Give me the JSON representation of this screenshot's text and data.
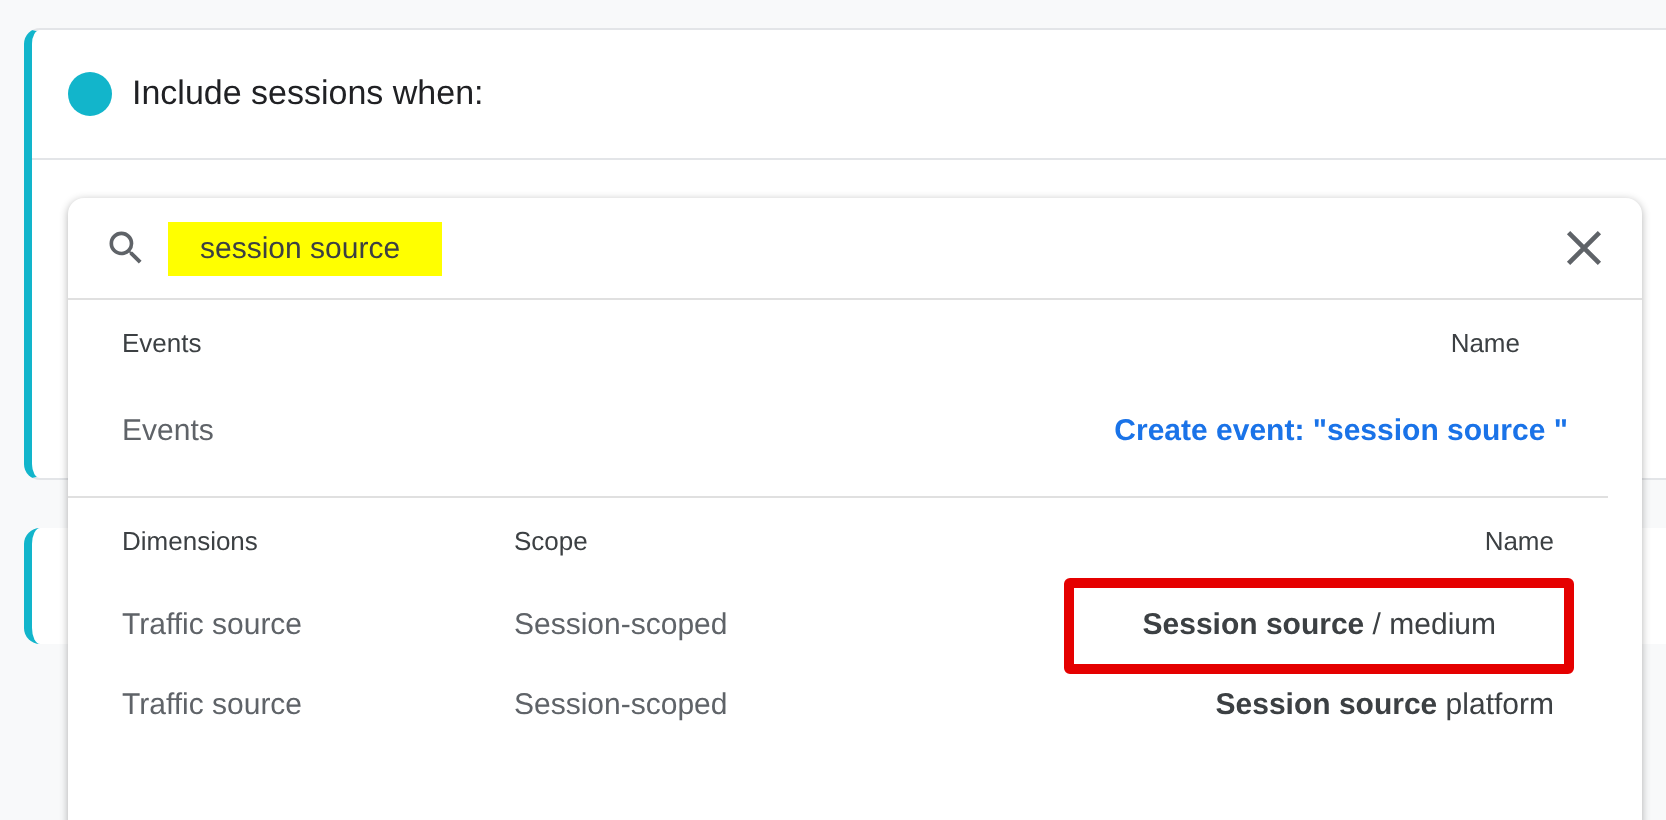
{
  "card": {
    "title": "Include sessions when:"
  },
  "search": {
    "value": "session source",
    "highlighted": true
  },
  "events": {
    "columns": [
      "Events",
      "Name"
    ],
    "rows": [
      {
        "category": "Events",
        "action": "Create event: \"session source \""
      }
    ]
  },
  "dimensions": {
    "columns": [
      "Dimensions",
      "Scope",
      "Name"
    ],
    "rows": [
      {
        "category": "Traffic source",
        "scope": "Session-scoped",
        "name": "**Session source** / medium",
        "outlined": true
      },
      {
        "category": "Traffic source",
        "scope": "Session-scoped",
        "name": "**Session source** platform",
        "outlined": false
      }
    ]
  }
}
